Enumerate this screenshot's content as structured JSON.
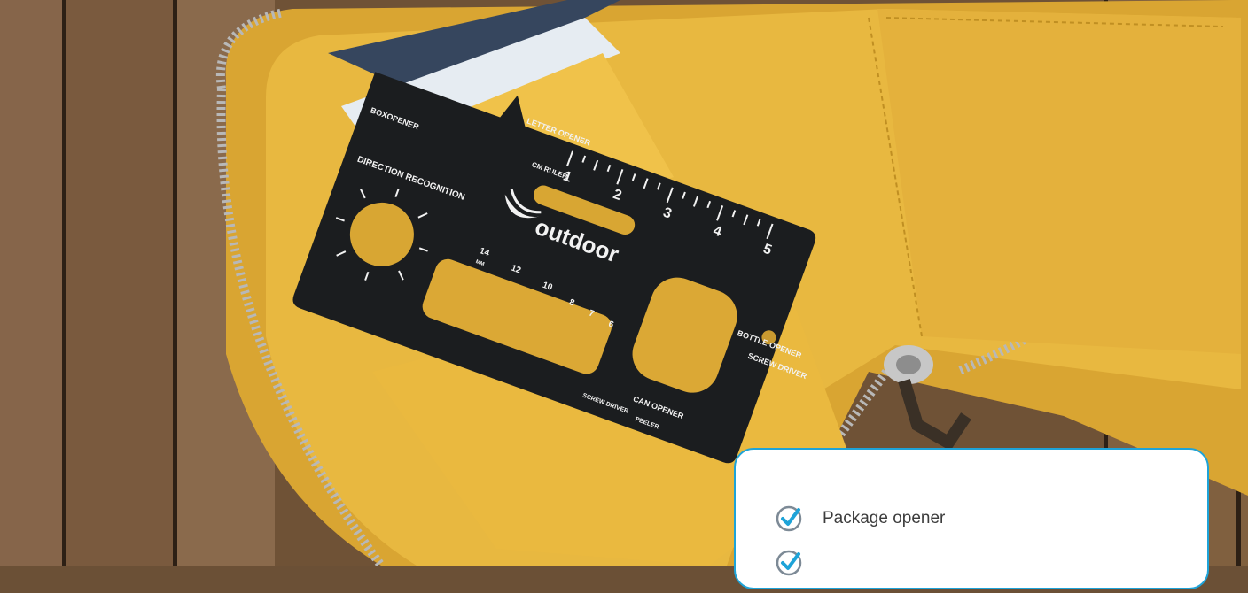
{
  "photo": {
    "subject": "outdoor multitool card on open yellow leather wallet",
    "brand": "outdoor",
    "tool_labels": [
      "LETTER OPENER",
      "BOXOPENER",
      "DIRECTION RECOGNITION",
      "CM RULER",
      "1",
      "2",
      "3",
      "4",
      "5",
      "14",
      "12",
      "10",
      "8",
      "7",
      "6",
      "MM",
      "BOTTLE OPENER",
      "SCREW DRIVER",
      "CAN OPENER",
      "SCREW DRIVER",
      "PEELER"
    ],
    "colors": {
      "wood": "#7a5a3c",
      "leather": "#e0b23c",
      "card": "#1b1d1f",
      "accent": "#1ea3d8"
    }
  },
  "features": {
    "items": [
      {
        "label": "Package opener",
        "icon": "check-circle-icon"
      },
      {
        "label": "",
        "icon": "check-circle-icon"
      }
    ]
  }
}
